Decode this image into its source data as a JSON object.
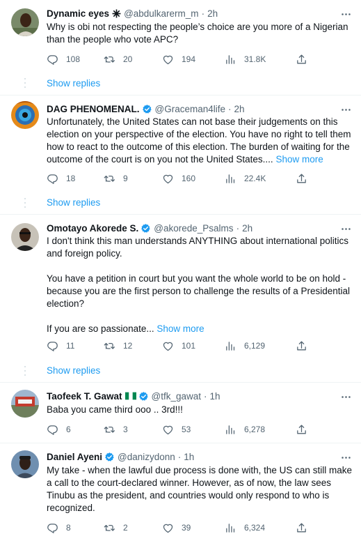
{
  "tweets": [
    {
      "name": "Dynamic eyes",
      "handle": "@abdulkarerm_m",
      "time": "2h",
      "text": "Why is obi not respecting the people’s choice are you more of a Nigerian than the people who vote APC?",
      "show_more": "",
      "replies": "108",
      "retweets": "20",
      "likes": "194",
      "views": "31.8K",
      "show_replies": "Show replies"
    },
    {
      "name": "DAG PHENOMENAL.",
      "handle": "@Graceman4life",
      "time": "2h",
      "text": "Unfortunately, the United States can not base their judgements on this election on your perspective of the election. You have no right to tell them how to react to the outcome of this election. The burden of waiting for the outcome of the court is on you not the United States....",
      "show_more": "Show more",
      "replies": "18",
      "retweets": "9",
      "likes": "160",
      "views": "22.4K",
      "show_replies": "Show replies"
    },
    {
      "name": "Omotayo Akorede S.",
      "handle": "@akorede_Psalms",
      "time": "2h",
      "text_p1": "I don't think this man understands ANYTHING about international politics and foreign policy.",
      "text_p2": "You have a petition in court but you want the whole world to be on hold - because you are the first person to challenge the results of a Presidential election?",
      "text_p3": "If you are so passionate...",
      "show_more": "Show more",
      "replies": "11",
      "retweets": "12",
      "likes": "101",
      "views": "6,129",
      "show_replies": "Show replies"
    },
    {
      "name": "Taofeek T. Gawat",
      "flag": "🇳🇬",
      "handle": "@tfk_gawat",
      "time": "1h",
      "text": "Baba you came third ooo .. 3rd!!!",
      "replies": "6",
      "retweets": "3",
      "likes": "53",
      "views": "6,278"
    },
    {
      "name": "Daniel Ayeni",
      "handle": "@danizydonn",
      "time": "1h",
      "text": "My take - when the lawful due process is done with, the US can still make a call to the court-declared winner. However, as of now, the law sees Tinubu as the president, and countries would only respond to who is recognized.",
      "replies": "8",
      "retweets": "2",
      "likes": "39",
      "views": "6,324"
    }
  ],
  "colors": {
    "verified_blue": "#1d9bf0",
    "secondary_text": "#536471",
    "divider": "#eff3f4"
  }
}
